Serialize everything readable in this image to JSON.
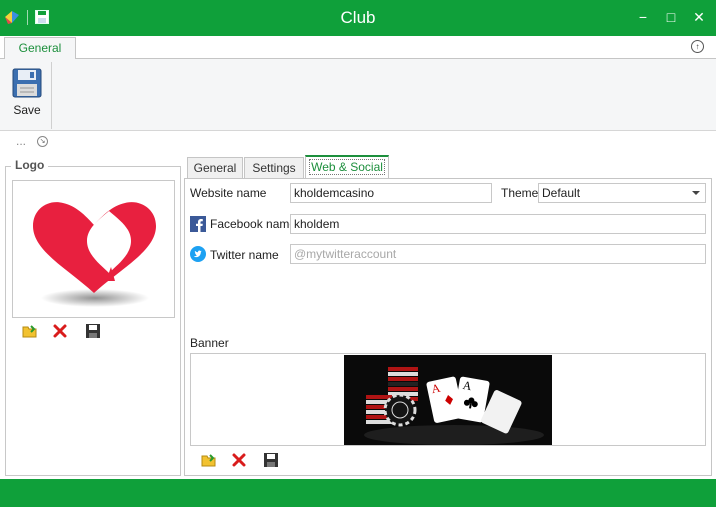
{
  "window": {
    "title": "Club",
    "app_icon": "app-logo-icon",
    "quick_save_icon": "floppy-disk-icon",
    "minimize_glyph": "−",
    "maximize_glyph": "□",
    "close_glyph": "✕"
  },
  "ribbon": {
    "tab_label": "General",
    "save_label": "Save",
    "collapse_glyph": "↑"
  },
  "sub_toolbar": {
    "dots": "...",
    "expand_glyph": "↘"
  },
  "logo_panel": {
    "legend": "Logo",
    "image": "heart-spade-logo",
    "actions": [
      "open-folder-icon",
      "delete-icon",
      "save-icon"
    ]
  },
  "tabs": [
    {
      "label": "General",
      "active": false
    },
    {
      "label": "Settings",
      "active": false
    },
    {
      "label": "Web & Social",
      "active": true
    }
  ],
  "web_social": {
    "website_label": "Website name",
    "website_value": "kholdemcasino",
    "theme_label": "Theme",
    "theme_value": "Default",
    "facebook_label": "Facebook name",
    "facebook_value": "kholdem",
    "twitter_label": "Twitter name",
    "twitter_placeholder": "@mytwitteraccount",
    "banner_label": "Banner",
    "banner_image": "poker-chips-cards-banner",
    "banner_actions": [
      "open-folder-icon",
      "delete-icon",
      "save-icon"
    ]
  },
  "colors": {
    "accent": "#0fa03a",
    "tab_accent": "#1c8f3c",
    "logo_red": "#e8203f",
    "facebook_blue": "#3b5998",
    "twitter_blue": "#1da1f2"
  }
}
